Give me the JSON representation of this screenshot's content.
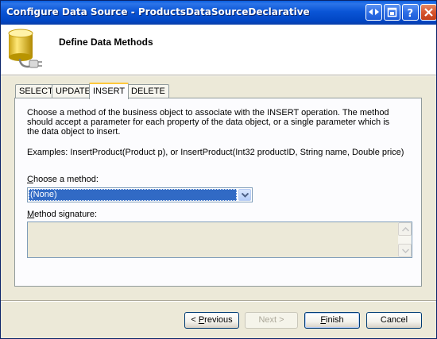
{
  "window": {
    "title": "Configure Data Source - ProductsDataSourceDeclarative",
    "buttons": [
      "help-back",
      "restore",
      "help",
      "close"
    ]
  },
  "header": {
    "title": "Define Data Methods",
    "icon": "database-plug-icon"
  },
  "tabs": [
    {
      "label": "SELECT",
      "active": false
    },
    {
      "label": "UPDATE",
      "active": false
    },
    {
      "label": "INSERT",
      "active": true
    },
    {
      "label": "DELETE",
      "active": false
    }
  ],
  "panel": {
    "description": "Choose a method of the business object to associate with the INSERT operation. The method should accept a parameter for each property of the data object, or a single parameter which is the data object to insert.",
    "examples": "Examples: InsertProduct(Product p), or InsertProduct(Int32 productID, String name, Double price)",
    "choose_label_key": "C",
    "choose_label_rest": "hoose a method:",
    "method_value": "(None)",
    "signature_label_key": "M",
    "signature_label_rest": "ethod signature:",
    "signature_value": ""
  },
  "footer": {
    "previous_prefix": "< ",
    "previous_key": "P",
    "previous_rest": "revious",
    "next_label": "Next >",
    "next_enabled": false,
    "finish_key": "F",
    "finish_rest": "inish",
    "cancel_label": "Cancel"
  },
  "colors": {
    "titlebar": "#0a55d6",
    "selection": "#316ac5",
    "active_tab_accent": "#ffc83c",
    "dialog_bg": "#ece9d8"
  }
}
